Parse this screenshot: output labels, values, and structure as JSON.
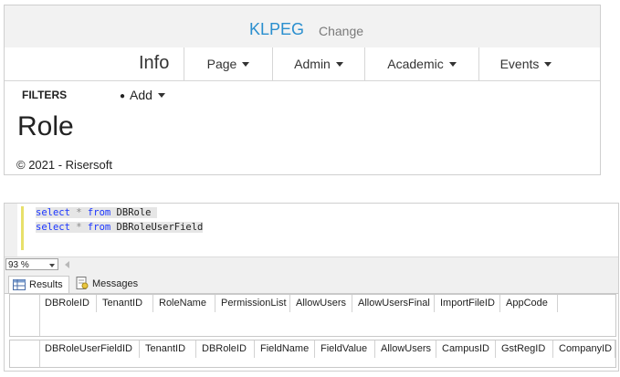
{
  "web": {
    "brand": "KLPEG",
    "change": "Change",
    "nav": {
      "info": "Info",
      "items": [
        "Page",
        "Admin",
        "Academic",
        "Events"
      ]
    },
    "filters": "FILTERS",
    "add": "Add",
    "title": "Role",
    "copyright": "© 2021 - Risersoft"
  },
  "ssms": {
    "query": {
      "line1": {
        "kw1": "select",
        "op": "*",
        "kw2": "from",
        "table": "DBRole"
      },
      "line2": {
        "kw1": "select",
        "op": "*",
        "kw2": "from",
        "table": "DBRoleUserField"
      }
    },
    "zoom": "93 %",
    "tabs": {
      "results": "Results",
      "messages": "Messages"
    },
    "grid1": {
      "columns": [
        "DBRoleID",
        "TenantID",
        "RoleName",
        "PermissionList",
        "AllowUsers",
        "AllowUsersFinal",
        "ImportFileID",
        "AppCode"
      ]
    },
    "grid2": {
      "columns": [
        "DBRoleUserFieldID",
        "TenantID",
        "DBRoleID",
        "FieldName",
        "FieldValue",
        "AllowUsers",
        "CampusID",
        "GstRegID",
        "CompanyID"
      ]
    }
  }
}
